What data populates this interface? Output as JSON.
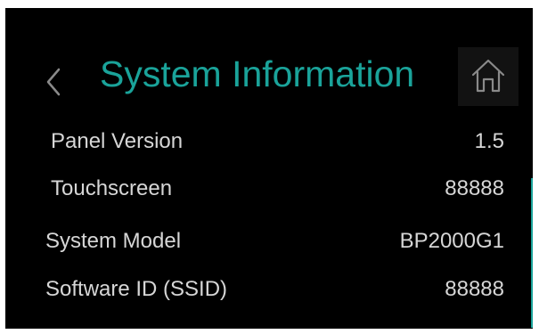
{
  "header": {
    "title": "System Information",
    "back_icon": "chevron-left-icon",
    "home_icon": "home-icon"
  },
  "info": {
    "rows": [
      {
        "label": "Panel Version",
        "value": "1.5"
      },
      {
        "label": "Touchscreen",
        "value": "88888"
      },
      {
        "label": "System Model",
        "value": "BP2000G1"
      },
      {
        "label": "Software ID (SSID)",
        "value": "88888"
      }
    ]
  },
  "colors": {
    "background": "#000000",
    "accent": "#1aa39a",
    "text": "#d6d6d6",
    "icon": "#8a8a8a",
    "home_button_bg": "#121212"
  }
}
